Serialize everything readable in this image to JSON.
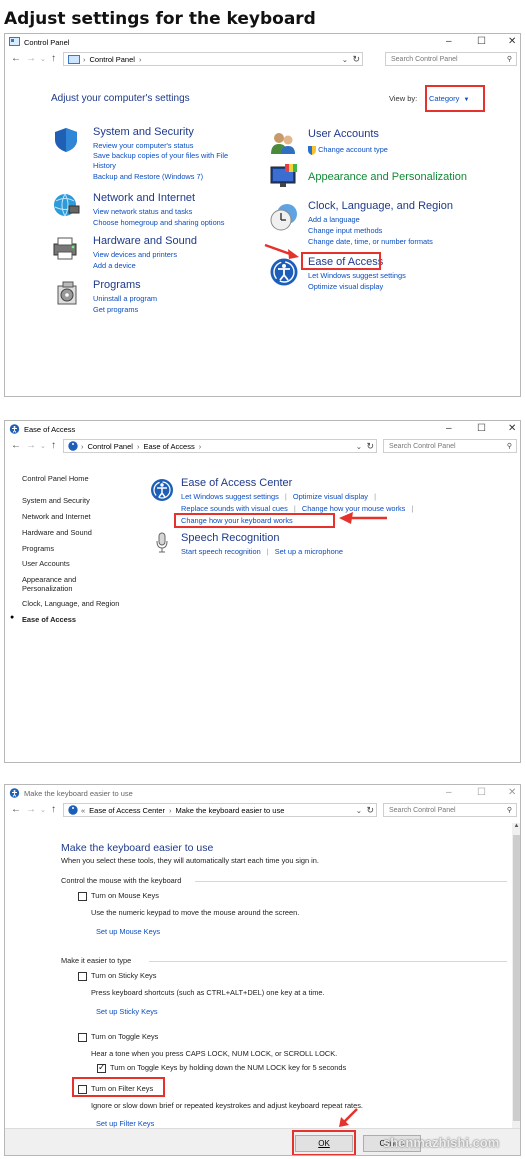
{
  "heading": "Adjust settings for the keyboard",
  "colors": {
    "link": "#0a4ec1",
    "heading_blue": "#1e3a8a",
    "heading_green": "#138a36",
    "highlight": "#e5322d"
  },
  "win1": {
    "title": "Control Panel",
    "address": "Control Panel",
    "search_placeholder": "Search Control Panel",
    "main_heading": "Adjust your computer's settings",
    "view_by_label": "View by:",
    "view_by_value": "Category",
    "categories_left": [
      {
        "icon": "shield-icon",
        "title": "System and Security",
        "links": [
          "Review your computer's status",
          "Save backup copies of your files with File",
          "History",
          "Backup and Restore (Windows 7)"
        ]
      },
      {
        "icon": "network-globe-icon",
        "title": "Network and Internet",
        "links": [
          "View network status and tasks",
          "Choose homegroup and sharing options"
        ]
      },
      {
        "icon": "printer-icon",
        "title": "Hardware and Sound",
        "links": [
          "View devices and printers",
          "Add a device"
        ]
      },
      {
        "icon": "programs-disc-icon",
        "title": "Programs",
        "links": [
          "Uninstall a program",
          "Get programs"
        ]
      }
    ],
    "categories_right": [
      {
        "icon": "users-icon",
        "title": "User Accounts",
        "links": [
          "Change account type"
        ]
      },
      {
        "icon": "monitor-paint-icon",
        "title": "Appearance and Personalization",
        "links": []
      },
      {
        "icon": "clock-globe-icon",
        "title": "Clock, Language, and Region",
        "links": [
          "Add a language",
          "Change input methods",
          "Change date, time, or number formats"
        ]
      },
      {
        "icon": "ease-of-access-icon",
        "title": "Ease of Access",
        "links": [
          "Let Windows suggest settings",
          "Optimize visual display"
        ]
      }
    ]
  },
  "win2": {
    "title": "Ease of Access",
    "breadcrumb": [
      "Control Panel",
      "Ease of Access"
    ],
    "search_placeholder": "Search Control Panel",
    "nav": [
      "Control Panel Home",
      "System and Security",
      "Network and Internet",
      "Hardware and Sound",
      "Programs",
      "User Accounts",
      "Appearance and",
      "Personalization",
      "Clock, Language, and Region",
      "Ease of Access"
    ],
    "center_title": "Ease of Access Center",
    "center_links": [
      "Let Windows suggest settings",
      "Optimize visual display",
      "Replace sounds with visual cues",
      "Change how your mouse works",
      "Change how your keyboard works"
    ],
    "speech_title": "Speech Recognition",
    "speech_links": [
      "Start speech recognition",
      "Set up a microphone"
    ]
  },
  "win3": {
    "title": "Make the keyboard easier to use",
    "breadcrumb": [
      "Ease of Access Center",
      "Make the keyboard easier to use"
    ],
    "search_placeholder": "Search Control Panel",
    "heading": "Make the keyboard easier to use",
    "subheading": "When you select these tools, they will automatically start each time you sign in.",
    "section1": "Control the mouse with the keyboard",
    "mouse_keys": {
      "label": "Turn on Mouse Keys",
      "checked": false,
      "desc": "Use the numeric keypad to move the mouse around the screen.",
      "link": "Set up Mouse Keys"
    },
    "section2": "Make it easier to type",
    "sticky_keys": {
      "label": "Turn on Sticky Keys",
      "checked": false,
      "desc": "Press keyboard shortcuts (such as CTRL+ALT+DEL) one key at a time.",
      "link": "Set up Sticky Keys"
    },
    "toggle_keys": {
      "label": "Turn on Toggle Keys",
      "checked": false,
      "desc": "Hear a tone when you press CAPS LOCK, NUM LOCK, or SCROLL LOCK.",
      "sub_label": "Turn on Toggle Keys by holding down the NUM LOCK key for 5 seconds",
      "sub_checked": true
    },
    "filter_keys": {
      "label": "Turn on Filter Keys",
      "checked": false,
      "desc": "Ignore or slow down brief or repeated keystrokes and adjust keyboard repeat rates.",
      "link": "Set up Filter Keys"
    },
    "ok_label": "OK",
    "cancel_label": "Cancel"
  },
  "watermark": "shenmazhishi.com"
}
